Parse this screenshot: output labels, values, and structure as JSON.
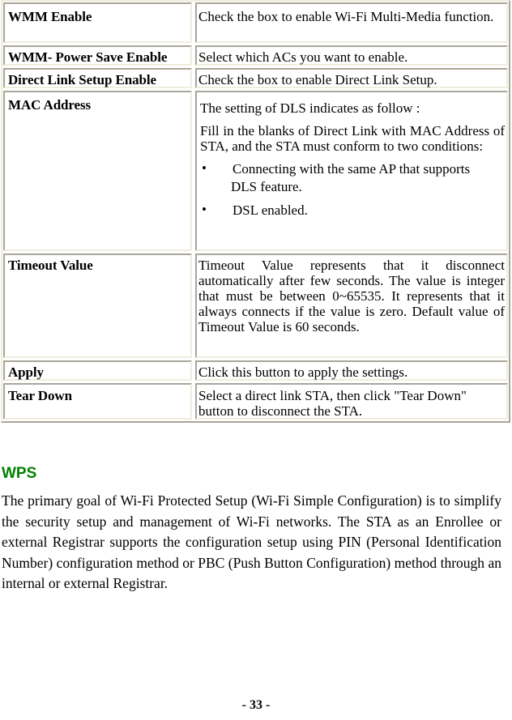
{
  "settings_table": {
    "rows": [
      {
        "label": "WMM Enable",
        "description": "Check the box to enable Wi-Fi Multi-Media function."
      },
      {
        "label": "WMM- Power Save Enable",
        "description": "Select which ACs you want to enable."
      },
      {
        "label": "Direct Link Setup Enable",
        "description": "Check the box to enable Direct Link Setup."
      },
      {
        "label": "MAC Address",
        "intro": "The setting of DLS indicates as follow :",
        "paragraph": "Fill in the blanks of Direct Link with MAC Address of STA, and the STA must conform to two conditions:",
        "bullets": [
          {
            "mark": "•",
            "line1": "Connecting with the same AP that supports",
            "line2": "DLS feature."
          },
          {
            "mark": "•",
            "line1": "DSL enabled."
          }
        ]
      },
      {
        "label": "Timeout Value",
        "description": "Timeout Value represents that it disconnect automatically after few seconds. The value is integer that must be between 0~65535. It represents that it always connects if the value is zero. Default value of Timeout Value is 60 seconds."
      },
      {
        "label": "Apply",
        "description": "Click this button to apply the settings."
      },
      {
        "label": "Tear Down",
        "description": "Select a direct link STA, then click \"Tear Down\" button to disconnect the STA."
      }
    ]
  },
  "wps_section": {
    "heading": "WPS",
    "heading_color": "#008000",
    "body": "The primary goal of Wi-Fi Protected Setup (Wi-Fi Simple Configuration) is to simplify the security setup and management of Wi-Fi networks. The STA as an Enrollee or external Registrar supports the configuration setup using PIN (Personal Identification Number) configuration method or PBC (Push Button Configuration) method through an internal or external Registrar."
  },
  "footer": {
    "page_number": "- 33 -"
  }
}
